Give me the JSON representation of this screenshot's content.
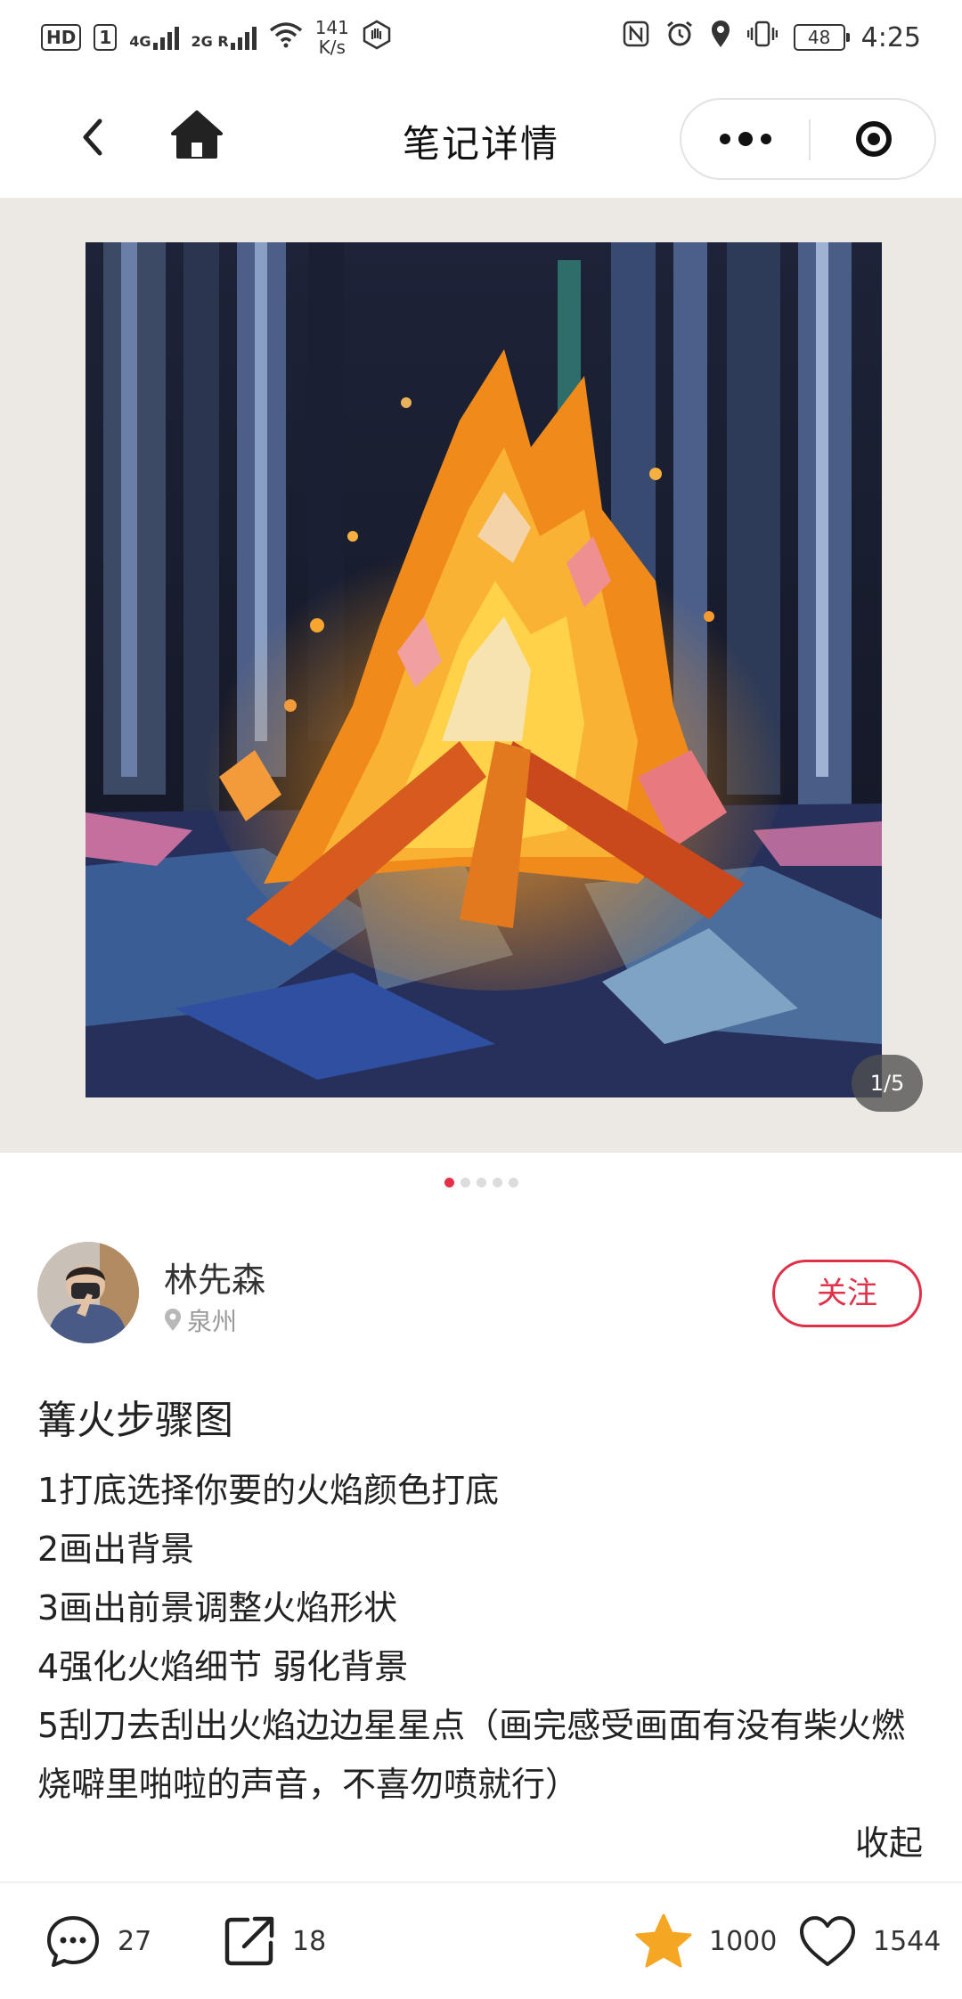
{
  "status_bar": {
    "hd_label": "HD",
    "sim_label": "1",
    "signal1_label": "4G",
    "signal2_label": "2G R",
    "net_speed_value": "141",
    "net_speed_unit": "K/s",
    "battery": "48",
    "time": "4:25"
  },
  "nav": {
    "title": "笔记详情"
  },
  "gallery": {
    "counter": "1/5",
    "total_images": 5,
    "active_index": 0
  },
  "author": {
    "name": "林先森",
    "location": "泉州",
    "follow_label": "关注"
  },
  "note": {
    "title": "篝火步骤图",
    "lines": [
      "1打底选择你要的火焰颜色打底",
      "2画出背景",
      "3画出前景调整火焰形状",
      "4强化火焰细节 弱化背景",
      "5刮刀去刮出火焰边边星星点（画完感受画面有没有柴火燃烧噼里啪啦的声音，不喜勿喷就行）"
    ],
    "collapse_label": "收起"
  },
  "actions": {
    "comments": "27",
    "shares": "18",
    "favorites": "1000",
    "likes": "1544"
  },
  "colors": {
    "accent": "#e0304a",
    "star": "#f5a623"
  }
}
